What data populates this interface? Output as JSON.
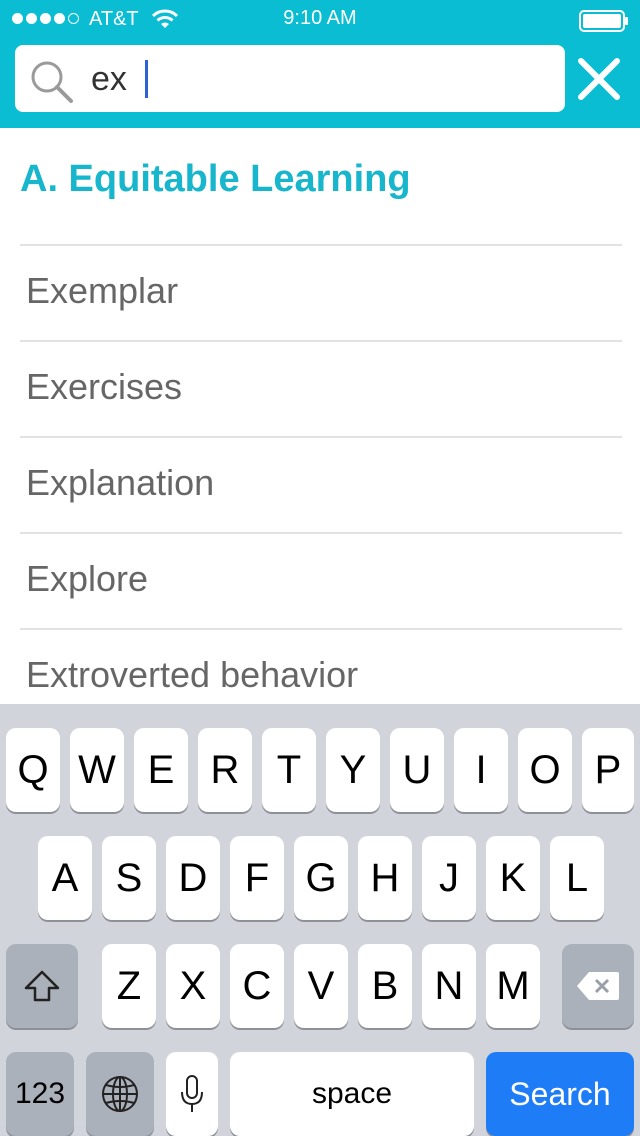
{
  "status_bar": {
    "carrier": "AT&T",
    "time": "9:10 AM"
  },
  "search": {
    "query": "ex"
  },
  "results": {
    "section_title": "A. Equitable Learning",
    "items": [
      {
        "label": "Exemplar"
      },
      {
        "label": "Exercises"
      },
      {
        "label": "Explanation"
      },
      {
        "label": "Explore"
      },
      {
        "label": "Extroverted behavior"
      }
    ]
  },
  "keyboard": {
    "row1": [
      "Q",
      "W",
      "E",
      "R",
      "T",
      "Y",
      "U",
      "I",
      "O",
      "P"
    ],
    "row2": [
      "A",
      "S",
      "D",
      "F",
      "G",
      "H",
      "J",
      "K",
      "L"
    ],
    "row3": [
      "Z",
      "X",
      "C",
      "V",
      "B",
      "N",
      "M"
    ],
    "numbers_label": "123",
    "space_label": "space",
    "search_label": "Search"
  },
  "colors": {
    "accent": "#0ABDD3",
    "title": "#17B6CC",
    "search_key": "#1E7CF6"
  }
}
